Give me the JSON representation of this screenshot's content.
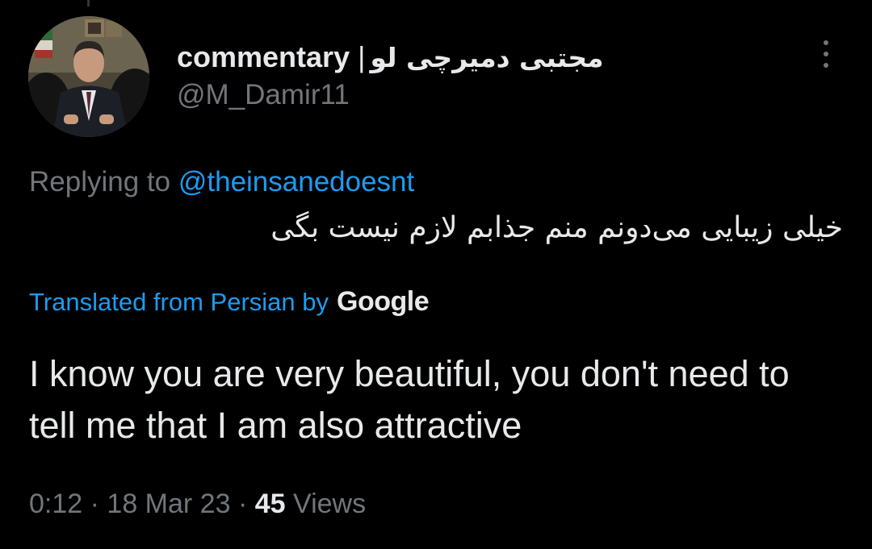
{
  "tweet": {
    "author": {
      "name_latin": "commentary",
      "name_separator": "|",
      "name_persian": "مجتبی دمیرچی لو",
      "handle": "@M_Damir11"
    },
    "reply": {
      "prefix": "Replying to",
      "target": "@theinsanedoesnt"
    },
    "original_text": "خیلی زیبایی می‌دونم منم جذابم لازم نیست بگی",
    "translation": {
      "label": "Translated from Persian by",
      "provider": "Google",
      "text": "I know you are very beautiful, you don't need to tell me that I am also attractive"
    },
    "meta": {
      "time": "0:12",
      "separator": "·",
      "date": "18 Mar 23",
      "views_count": "45",
      "views_label": "Views"
    },
    "icons": {
      "more": "more-vertical-icon",
      "avatar": "profile-photo"
    },
    "colors": {
      "background": "#000000",
      "text_primary": "#e7e9ea",
      "text_secondary": "#71767b",
      "accent": "#1d9bf0"
    }
  }
}
